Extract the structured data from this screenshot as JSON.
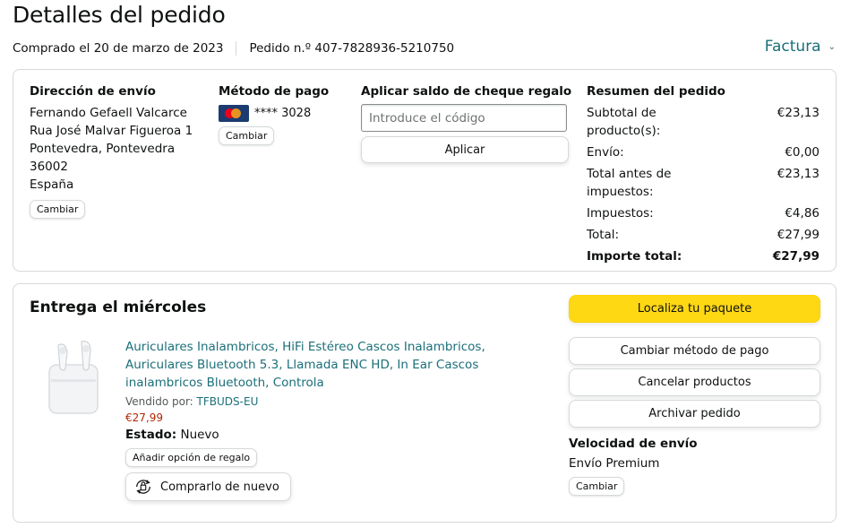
{
  "header": {
    "title": "Detalles del pedido",
    "purchased": "Comprado el 20 de marzo de 2023",
    "order_number": "Pedido n.º 407-7828936-5210750",
    "invoice_label": "Factura"
  },
  "shipping": {
    "heading": "Dirección de envío",
    "lines": [
      "Fernando Gefaell Valcarce",
      "Rua José Malvar Figueroa 1",
      "Pontevedra, Pontevedra 36002",
      "España"
    ],
    "change_label": "Cambiar"
  },
  "payment": {
    "heading": "Método de pago",
    "card_icon": "mastercard-icon",
    "card_digits": "**** 3028",
    "change_label": "Cambiar"
  },
  "gift_card": {
    "heading": "Aplicar saldo de cheque regalo",
    "placeholder": "Introduce el código",
    "apply_label": "Aplicar"
  },
  "summary": {
    "heading": "Resumen del pedido",
    "rows": [
      {
        "label": "Subtotal de producto(s):",
        "value": "€23,13"
      },
      {
        "label": "Envío:",
        "value": "€0,00"
      },
      {
        "label": "Total antes de impuestos:",
        "value": "€23,13"
      },
      {
        "label": "Impuestos:",
        "value": "€4,86"
      },
      {
        "label": "Total:",
        "value": "€27,99"
      }
    ],
    "grand_total_label": "Importe total:",
    "grand_total_value": "€27,99"
  },
  "delivery": {
    "title": "Entrega el miércoles",
    "product": {
      "image_icon": "earbuds-image",
      "title": "Auriculares Inalambricos, HiFi Estéreo Cascos Inalambricos, Auriculares Bluetooth 5.3, Llamada ENC HD, In Ear Cascos inalambricos Bluetooth, Controla",
      "sold_by_label": "Vendido por:",
      "seller": "TFBUDS-EU",
      "price": "€27,99",
      "status_label": "Estado:",
      "status_value": "Nuevo",
      "gift_option_label": "Añadir opción de regalo",
      "rebuy_label": "Comprarlo de nuevo"
    },
    "actions": {
      "track": "Localiza tu paquete",
      "change_payment": "Cambiar método de pago",
      "cancel": "Cancelar productos",
      "archive": "Archivar pedido"
    },
    "shipping_speed": {
      "heading": "Velocidad de envío",
      "value": "Envío Premium",
      "change_label": "Cambiar"
    }
  },
  "colors": {
    "link": "#1b6f79",
    "price": "#b12704",
    "primary_button": "#ffd814",
    "border": "#d5d9d9"
  }
}
